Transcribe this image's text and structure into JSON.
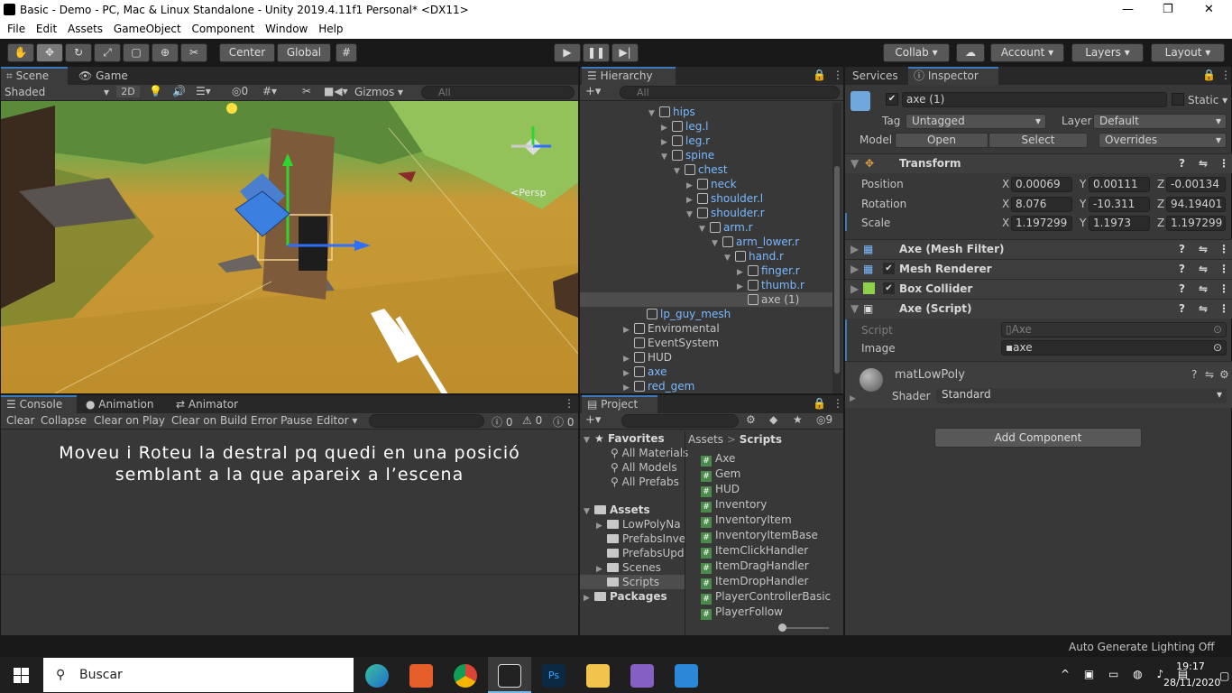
{
  "window": {
    "title": "Basic - Demo - PC, Mac & Linux Standalone - Unity 2019.4.11f1 Personal* <DX11>",
    "min": "—",
    "max": "❐",
    "close": "✕"
  },
  "menu": [
    "File",
    "Edit",
    "Assets",
    "GameObject",
    "Component",
    "Window",
    "Help"
  ],
  "toolbar": {
    "center": "Center",
    "global": "Global",
    "collab": "Collab",
    "account": "Account",
    "layers": "Layers",
    "layout": "Layout"
  },
  "scene": {
    "tab_scene": "Scene",
    "tab_game": "Game",
    "shading": "Shaded",
    "mode2d": "2D",
    "gizmos": "Gizmos",
    "search_placeholder": "All",
    "persp": "<Persp"
  },
  "hierarchy": {
    "tab": "Hierarchy",
    "search_placeholder": "All",
    "items": [
      {
        "label": "hips",
        "blue": true
      },
      {
        "label": "leg.l",
        "blue": true
      },
      {
        "label": "leg.r",
        "blue": true
      },
      {
        "label": "spine",
        "blue": true
      },
      {
        "label": "chest",
        "blue": true
      },
      {
        "label": "neck",
        "blue": true
      },
      {
        "label": "shoulder.l",
        "blue": true
      },
      {
        "label": "shoulder.r",
        "blue": true
      },
      {
        "label": "arm.r",
        "blue": true
      },
      {
        "label": "arm_lower.r",
        "blue": true
      },
      {
        "label": "hand.r",
        "blue": true
      },
      {
        "label": "finger.r",
        "blue": true
      },
      {
        "label": "thumb.r",
        "blue": true
      },
      {
        "label": "axe (1)",
        "blue": false
      },
      {
        "label": "lp_guy_mesh",
        "blue": true
      },
      {
        "label": "Enviromental",
        "blue": false
      },
      {
        "label": "EventSystem",
        "blue": false
      },
      {
        "label": "HUD",
        "blue": false
      },
      {
        "label": "axe",
        "blue": true
      },
      {
        "label": "red_gem",
        "blue": true
      }
    ]
  },
  "console": {
    "tab_console": "Console",
    "tab_animation": "Animation",
    "tab_animator": "Animator",
    "clear": "Clear",
    "collapse": "Collapse",
    "clear_on_play": "Clear on Play",
    "clear_on_build": "Clear on Build",
    "error_pause": "Error Pause",
    "editor": "Editor",
    "count_log": "0",
    "count_warn": "0",
    "count_err": "0",
    "overlay_line1": "Moveu i Roteu la destral pq quedi en una posició",
    "overlay_line2": "semblant a la que apareix a l’escena"
  },
  "project": {
    "tab": "Project",
    "favorites_label": "Favorites",
    "favorites": [
      "All Materials",
      "All Models",
      "All Prefabs"
    ],
    "assets_label": "Assets",
    "assets": [
      "LowPolyNa",
      "PrefabsInve",
      "PrefabsUpd",
      "Scenes",
      "Scripts"
    ],
    "packages_label": "Packages",
    "breadcrumb_root": "Assets",
    "breadcrumb_current": "Scripts",
    "files": [
      "Axe",
      "Gem",
      "HUD",
      "Inventory",
      "InventoryItem",
      "InventoryItemBase",
      "ItemClickHandler",
      "ItemDragHandler",
      "ItemDropHandler",
      "PlayerControllerBasic",
      "PlayerFollow"
    ],
    "hidden_count": "9"
  },
  "inspector": {
    "tab_services": "Services",
    "tab_inspector": "Inspector",
    "object_name": "axe (1)",
    "static_label": "Static",
    "tag_label": "Tag",
    "tag_value": "Untagged",
    "layer_label": "Layer",
    "layer_value": "Default",
    "model_label": "Model",
    "open": "Open",
    "select": "Select",
    "overrides": "Overrides",
    "transform": {
      "title": "Transform",
      "position_label": "Position",
      "rotation_label": "Rotation",
      "scale_label": "Scale",
      "pos": [
        "0.00069",
        "0.00111",
        "-0.00134"
      ],
      "rot": [
        "8.076",
        "-10.311",
        "94.19401"
      ],
      "scl": [
        "1.197299",
        "1.1973",
        "1.197299"
      ]
    },
    "mesh_filter": "Axe (Mesh Filter)",
    "mesh_renderer": "Mesh Renderer",
    "box_collider": "Box Collider",
    "axe_script": {
      "title": "Axe (Script)",
      "script_label": "Script",
      "script_value": "Axe",
      "image_label": "Image",
      "image_value": "axe"
    },
    "material": {
      "name": "matLowPoly",
      "shader_label": "Shader",
      "shader_value": "Standard"
    },
    "add_component": "Add Component"
  },
  "status": {
    "lighting": "Auto Generate Lighting Off"
  },
  "taskbar": {
    "search": "Buscar",
    "time": "19:17",
    "date": "28/11/2020"
  }
}
